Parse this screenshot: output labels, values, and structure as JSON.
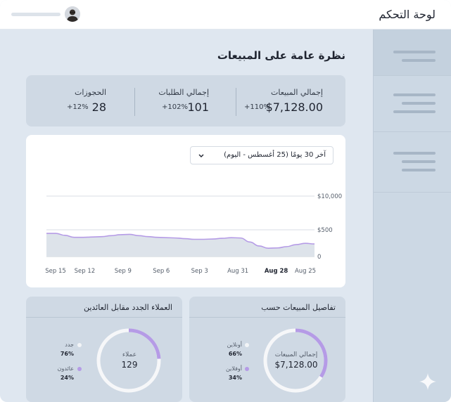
{
  "header": {
    "title": "لوحة التحكم",
    "user_avatar_icon": "user-avatar-icon"
  },
  "sidebar": {
    "items": [
      {
        "icon": "menu-lines-icon"
      },
      {
        "icon": "menu-lines-icon"
      },
      {
        "icon": "menu-lines-icon"
      }
    ]
  },
  "main": {
    "page_title": "نظرة عامة على المبيعات",
    "stats": [
      {
        "label": "إجمالي المبيعات",
        "value": "$7,128.00",
        "change": "+110%"
      },
      {
        "label": "إجمالي الطلبات",
        "value": "101",
        "change": "+102%"
      },
      {
        "label": "الحجوزات",
        "value": "28",
        "change": "+12%"
      }
    ]
  },
  "chart_card": {
    "range_select": "آخر 30 يومًا (25 أغسطس - اليوم)",
    "chevron_icon": "chevron-down-icon"
  },
  "chart_data": {
    "type": "area",
    "x": [
      "Aug 25",
      "Aug 28",
      "Aug 31",
      "Sep 3",
      "Sep 6",
      "Sep 9",
      "Sep 12",
      "Sep 15"
    ],
    "x_labels_order_left_to_right": [
      "Sep 15",
      "Sep 12",
      "Sep 9",
      "Sep 6",
      "Sep 3",
      "Aug 31",
      "Aug 28",
      "Aug 25"
    ],
    "highlighted_tick": "Aug 28",
    "y_tick_labels": [
      "$10,000",
      "$500",
      "0"
    ],
    "series": [
      {
        "values_left_to_right": [
          700,
          700,
          640,
          580,
          580,
          590,
          600,
          630,
          660,
          670,
          630,
          600,
          580,
          570,
          560,
          540,
          520,
          520,
          530,
          550,
          570,
          560,
          440,
          320,
          250,
          260,
          300,
          360,
          400,
          380
        ],
        "color": "#b59be6"
      }
    ],
    "y_scale": "non-linear (ticks 0, $500, $10,000)",
    "grid": true
  },
  "bottom_left": {
    "title": "العملاء الجدد مقابل العائدين",
    "center_label": "عملاء",
    "center_value": "129",
    "legend": [
      {
        "label": "جدد",
        "pct": "76%",
        "color": "#f2f4f7"
      },
      {
        "label": "عائدون",
        "pct": "24%",
        "color": "#b59be6"
      }
    ],
    "donut_fraction_highlight": 0.24
  },
  "bottom_right": {
    "title": "تفاصيل المبيعات حسب",
    "center_label": "إجمالي المبيعات",
    "center_value": "$7,128.00",
    "legend": [
      {
        "label": "أونلاين",
        "pct": "66%",
        "color": "#f2f4f7"
      },
      {
        "label": "أوفلاين",
        "pct": "34%",
        "color": "#b59be6"
      }
    ],
    "donut_fraction_highlight": 0.34
  },
  "colors": {
    "accent": "#b59be6",
    "panel": "#cfd9e4",
    "background": "#dfe7f0",
    "card": "#ffffff"
  }
}
